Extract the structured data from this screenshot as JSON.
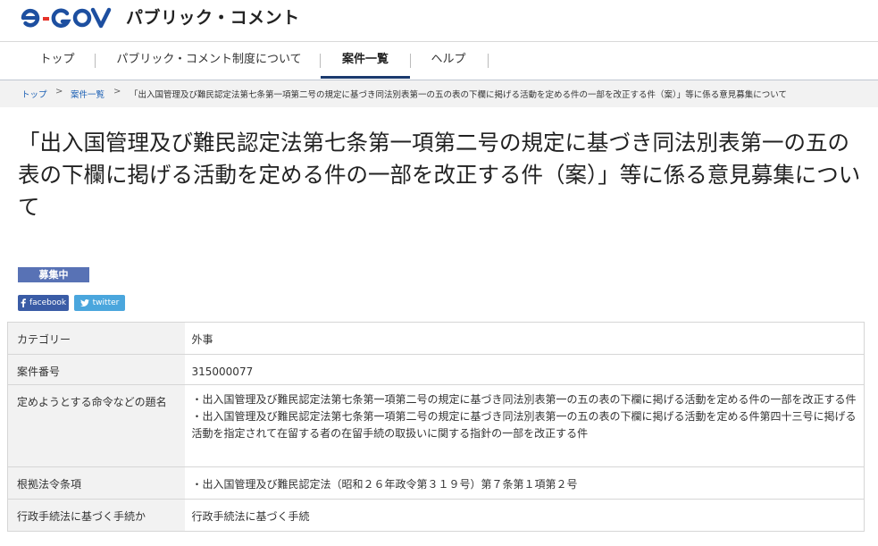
{
  "header": {
    "logo_text": "e-GOV",
    "site_title": "パブリック・コメント"
  },
  "nav": {
    "items": [
      {
        "label": "トップ"
      },
      {
        "label": "パブリック・コメント制度について"
      },
      {
        "label": "案件一覧"
      },
      {
        "label": "ヘルプ"
      }
    ],
    "active_index": 2
  },
  "breadcrumb": {
    "items": [
      {
        "label": "トップ"
      },
      {
        "label": "案件一覧"
      },
      {
        "label": "「出入国管理及び難民認定法第七条第一項第二号の規定に基づき同法別表第一の五の表の下欄に掲げる活動を定める件の一部を改正する件（案）」等に係る意見募集について"
      }
    ],
    "separator": ">"
  },
  "page": {
    "title": "「出入国管理及び難民認定法第七条第一項第二号の規定に基づき同法別表第一の五の表の下欄に掲げる活動を定める件の一部を改正する件（案）」等に係る意見募集について",
    "status_badge": "募集中"
  },
  "share": {
    "facebook_label": "facebook",
    "twitter_label": "twitter"
  },
  "details": {
    "rows": [
      {
        "label": "カテゴリー",
        "value": "外事"
      },
      {
        "label": "案件番号",
        "value": "315000077"
      },
      {
        "label": "定めようとする命令などの題名",
        "lines": [
          "・出入国管理及び難民認定法第七条第一項第二号の規定に基づき同法別表第一の五の表の下欄に掲げる活動を定める件の一部を改正する件",
          "・出入国管理及び難民認定法第七条第一項第二号の規定に基づき同法別表第一の五の表の下欄に掲げる活動を定める件第四十三号に掲げる活動を指定されて在留する者の在留手続の取扱いに関する指針の一部を改正する件"
        ]
      },
      {
        "label": "根拠法令条項",
        "value": "・出入国管理及び難民認定法（昭和２６年政令第３１９号）第７条第１項第２号"
      },
      {
        "label": "行政手続法に基づく手続か",
        "value": "行政手続法に基づく手続"
      }
    ]
  },
  "colors": {
    "brand_navy": "#1a3a6e",
    "logo_blue": "#1d4fa0",
    "badge": "#5872b5",
    "facebook": "#3a5ca6",
    "twitter": "#4aa6dd",
    "link": "#1a5fb4"
  }
}
